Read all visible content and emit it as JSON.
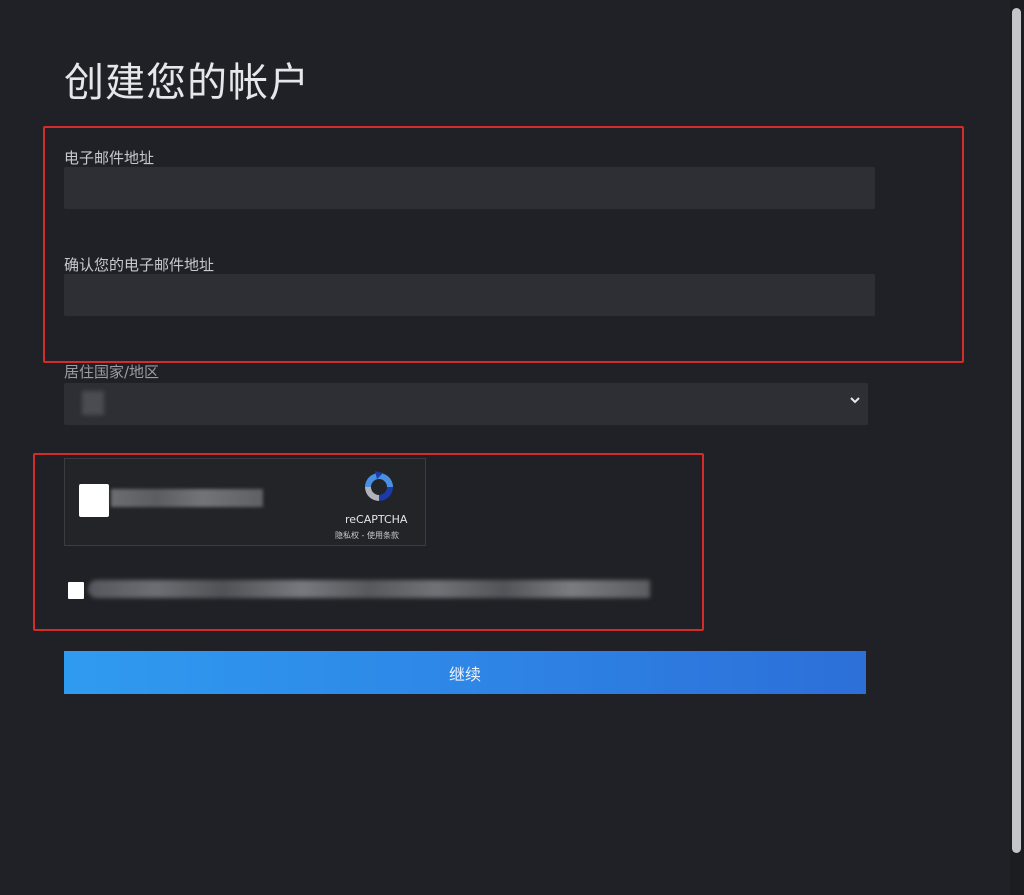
{
  "page": {
    "title": "创建您的帐户"
  },
  "form": {
    "email_label": "电子邮件地址",
    "email_value": "",
    "confirm_email_label": "确认您的电子邮件地址",
    "confirm_email_value": "",
    "country_label": "居住国家/地区",
    "country_value": ""
  },
  "captcha": {
    "brand": "reCAPTCHA",
    "links": "隐私权 - 使用条款",
    "checked": false
  },
  "terms": {
    "checked": false
  },
  "actions": {
    "continue_label": "继续"
  },
  "colors": {
    "background": "#1f2126",
    "input_bg": "#2d2f35",
    "button_gradient_start": "#2f9bf0",
    "button_gradient_end": "#2c6fd8",
    "highlight": "#d42b2b"
  },
  "icons": {
    "select_chevron": "chevron-down-icon",
    "captcha_logo": "recaptcha-logo-icon"
  }
}
